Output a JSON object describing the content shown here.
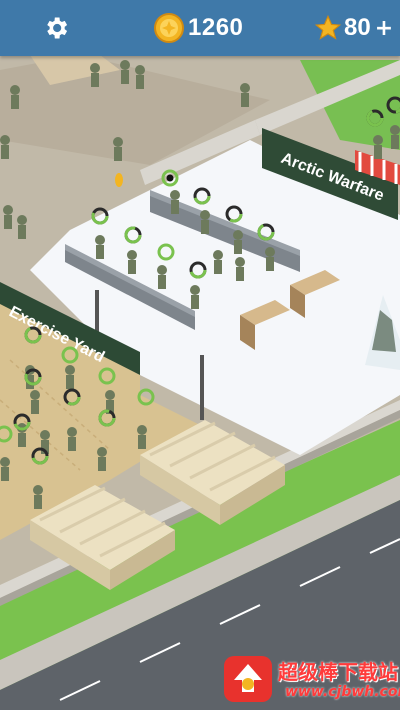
{
  "hud": {
    "settings_icon": "gear-icon",
    "coins": "1260",
    "coin_icon": "coin-icon",
    "stars": "80",
    "star_icon": "star-icon",
    "add_label": "+"
  },
  "buildings": {
    "arctic_sign": "Arctic Warfare",
    "exercise_sign": "Exercise Yard"
  },
  "watermark": {
    "title": "超级棒下载站",
    "url": "www.cjbwh.com"
  },
  "colors": {
    "topbar": "#3f79a9",
    "grass": "#7ac24e",
    "snow": "#f4f7fa",
    "sign": "#2d4a35",
    "coin": "#f3b522",
    "star": "#f3b522"
  }
}
